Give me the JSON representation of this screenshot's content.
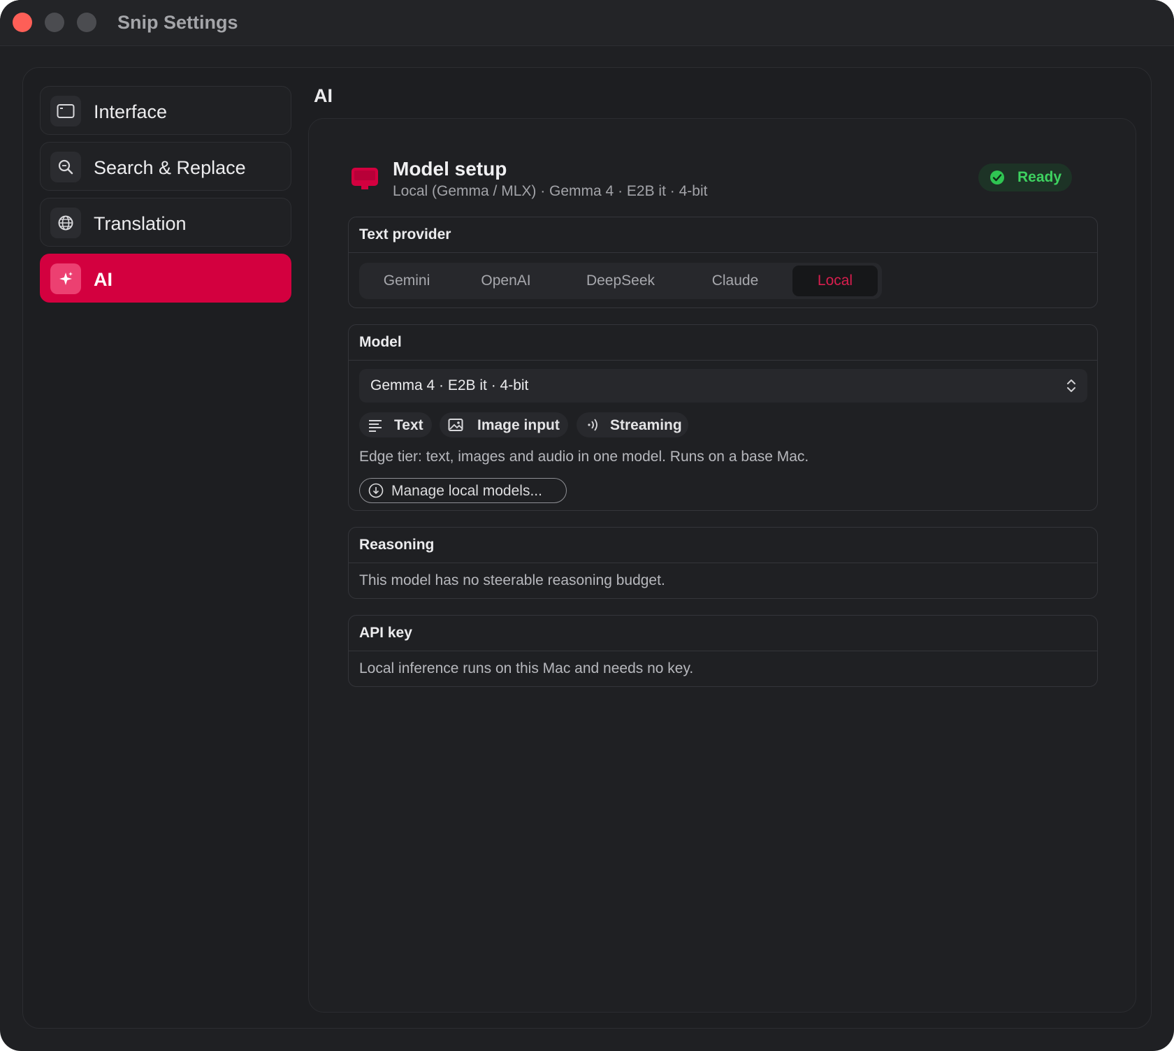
{
  "window": {
    "title": "Snip Settings"
  },
  "sidebar": {
    "items": [
      {
        "label": "Interface",
        "icon": "window-icon"
      },
      {
        "label": "Search & Replace",
        "icon": "search-icon"
      },
      {
        "label": "Translation",
        "icon": "globe-icon"
      },
      {
        "label": "AI",
        "icon": "sparkle-icon",
        "active": true
      }
    ]
  },
  "main": {
    "section_title": "AI",
    "header": {
      "title": "Model setup",
      "subtitle": "Local (Gemma / MLX) · Gemma 4 · E2B it · 4-bit",
      "status": "Ready"
    },
    "text_provider": {
      "heading": "Text provider",
      "options": [
        "Gemini",
        "OpenAI",
        "DeepSeek",
        "Claude",
        "Local"
      ],
      "selected": "Local"
    },
    "model": {
      "heading": "Model",
      "selected": "Gemma 4 · E2B it · 4-bit",
      "capabilities": [
        "Text",
        "Image input",
        "Streaming"
      ],
      "description": "Edge tier: text, images and audio in one model. Runs on a base Mac.",
      "manage_label": "Manage local models..."
    },
    "reasoning": {
      "heading": "Reasoning",
      "text": "This model has no steerable reasoning budget."
    },
    "api_key": {
      "heading": "API key",
      "text": "Local inference runs on this Mac and needs no key."
    }
  },
  "colors": {
    "accent": "#d3003f",
    "ready_green": "#3ed160",
    "window_bg": "#1f2023"
  }
}
